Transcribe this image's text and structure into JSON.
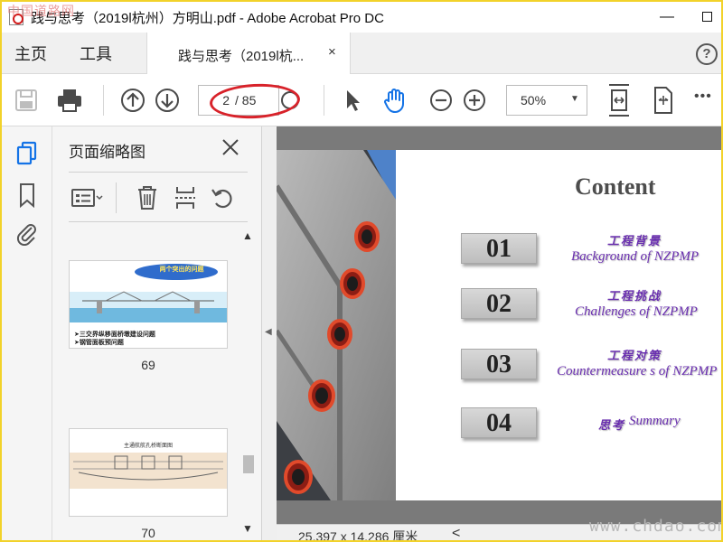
{
  "window": {
    "title": "践与思考（2019l杭州）方明山.pdf - Adobe Acrobat Pro DC",
    "minimize": "—",
    "watermark_top_left": "中国道路网"
  },
  "menu": {
    "home": "主页",
    "tools": "工具"
  },
  "tab": {
    "label": "践与思考（2019l杭...",
    "close": "×"
  },
  "help": "?",
  "toolbar": {
    "page_input": "2",
    "page_total": "/ 85",
    "zoom": "50%",
    "zoom_caret": "▼",
    "more": "•••"
  },
  "thumbnail_panel": {
    "title": "页面缩略图",
    "thumbs": [
      {
        "page": "69",
        "title": "两个突出的问题",
        "lines": [
          "➤三交界纵移面桥墩建设问题",
          "➤钢管面板预问题"
        ]
      },
      {
        "page": "70",
        "title": "主通航航孔桥断面图"
      }
    ]
  },
  "slide": {
    "title": "Content",
    "items": [
      {
        "num": "01",
        "cn": "工程背景",
        "en": "Background of NZPMP"
      },
      {
        "num": "02",
        "cn": "工程挑战",
        "en": "Challenges of NZPMP"
      },
      {
        "num": "03",
        "cn": "工程对策",
        "en": "Countermeasure s of NZPMP"
      },
      {
        "num": "04",
        "cn": "思考",
        "en": "Summary"
      }
    ]
  },
  "status": {
    "size": "25.397 x 14.286 厘米",
    "arrow": "<",
    "watermark": "www.chdao.com"
  },
  "colors": {
    "accent_blue": "#1473e6",
    "item_purple": "#6a2fb0",
    "highlight_red": "#d8222a",
    "frame_yellow": "#f2d22a"
  }
}
